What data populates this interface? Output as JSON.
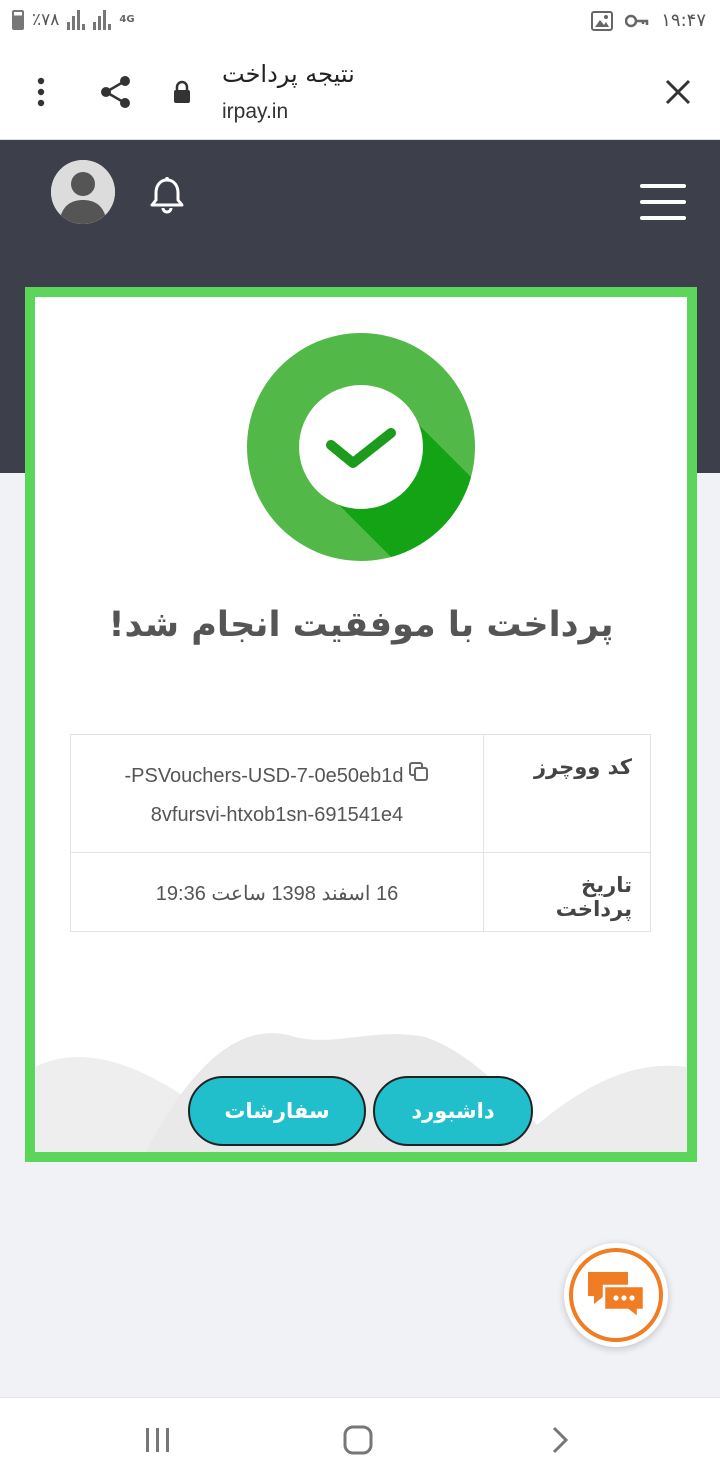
{
  "status_bar": {
    "battery_text": "٪۷۸",
    "network_type": "4G",
    "time": "۱۹:۴۷"
  },
  "browser": {
    "page_title": "نتیجه پرداخت",
    "url": "irpay.in"
  },
  "result": {
    "headline": "پرداخت با موفقیت انجام شد!",
    "rows": [
      {
        "label": "کد ووچرز",
        "value_line1": "PSVouchers-USD-7-0e50eb1d-",
        "value_line2": "8vfursvi-htxob1sn-691541e4"
      },
      {
        "label": "تاریخ پرداخت",
        "value": "16 اسفند 1398 ساعت 19:36"
      }
    ],
    "buttons": {
      "dashboard": "داشبورد",
      "orders": "سفارشات"
    }
  },
  "colors": {
    "header_bg": "#3d3f4a",
    "card_border": "#5cd65a",
    "success_green": "#52b848",
    "button_teal": "#20bfcb",
    "chat_orange": "#f07c24"
  },
  "icons": {
    "browser": [
      "more-vert-icon",
      "share-icon",
      "lock-icon",
      "close-icon"
    ],
    "header": [
      "avatar",
      "bell-icon",
      "hamburger-menu-icon"
    ],
    "nav": [
      "recents-icon",
      "home-icon",
      "back-icon"
    ]
  }
}
